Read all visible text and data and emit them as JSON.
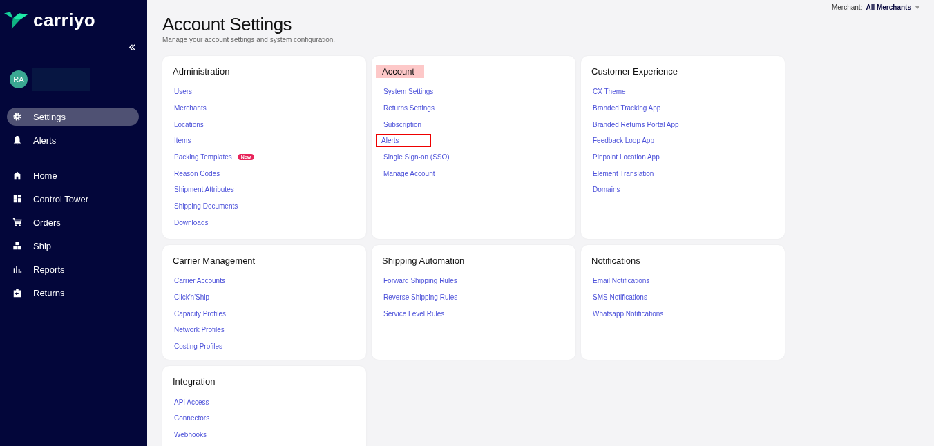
{
  "sidebar": {
    "logo_text": "carriyo",
    "avatar_initials": "RA",
    "top_items": [
      {
        "label": "Settings",
        "selected": true
      },
      {
        "label": "Alerts",
        "selected": false
      }
    ],
    "nav_items": [
      {
        "label": "Home",
        "selected": false
      },
      {
        "label": "Control Tower",
        "selected": false
      },
      {
        "label": "Orders",
        "selected": false
      },
      {
        "label": "Ship",
        "selected": false
      },
      {
        "label": "Reports",
        "selected": false
      },
      {
        "label": "Returns",
        "selected": false
      }
    ]
  },
  "header": {
    "merchant_label": "Merchant:",
    "merchant_value": "All Merchants",
    "title": "Account Settings",
    "subtitle": "Manage your account settings and system configuration."
  },
  "cards": [
    {
      "title": "Administration",
      "highlighted": false,
      "links": [
        {
          "label": "Users",
          "outlined": false
        },
        {
          "label": "Merchants",
          "outlined": false
        },
        {
          "label": "Locations",
          "outlined": false
        },
        {
          "label": "Items",
          "outlined": false
        },
        {
          "label": "Packing Templates",
          "badge": "New",
          "outlined": false
        },
        {
          "label": "Reason Codes",
          "outlined": false
        },
        {
          "label": "Shipment Attributes",
          "outlined": false
        },
        {
          "label": "Shipping Documents",
          "outlined": false
        },
        {
          "label": "Downloads",
          "outlined": false
        }
      ]
    },
    {
      "title": "Account",
      "highlighted": true,
      "links": [
        {
          "label": "System Settings",
          "outlined": false
        },
        {
          "label": "Returns Settings",
          "outlined": false
        },
        {
          "label": "Subscription",
          "outlined": false
        },
        {
          "label": "Alerts",
          "outlined": true
        },
        {
          "label": "Single Sign-on (SSO)",
          "outlined": false
        },
        {
          "label": "Manage Account",
          "outlined": false
        }
      ]
    },
    {
      "title": "Customer Experience",
      "highlighted": false,
      "links": [
        {
          "label": "CX Theme",
          "outlined": false
        },
        {
          "label": "Branded Tracking App",
          "outlined": false
        },
        {
          "label": "Branded Returns Portal App",
          "outlined": false
        },
        {
          "label": "Feedback Loop App",
          "outlined": false
        },
        {
          "label": "Pinpoint Location App",
          "outlined": false
        },
        {
          "label": "Element Translation",
          "outlined": false
        },
        {
          "label": "Domains",
          "outlined": false
        }
      ]
    },
    {
      "title": "Carrier Management",
      "highlighted": false,
      "links": [
        {
          "label": "Carrier Accounts",
          "outlined": false
        },
        {
          "label": "Click'n'Ship",
          "outlined": false
        },
        {
          "label": "Capacity Profiles",
          "outlined": false
        },
        {
          "label": "Network Profiles",
          "outlined": false
        },
        {
          "label": "Costing Profiles",
          "outlined": false
        }
      ]
    },
    {
      "title": "Shipping Automation",
      "highlighted": false,
      "links": [
        {
          "label": "Forward Shipping Rules",
          "outlined": false
        },
        {
          "label": "Reverse Shipping Rules",
          "outlined": false
        },
        {
          "label": "Service Level Rules",
          "outlined": false
        }
      ]
    },
    {
      "title": "Notifications",
      "highlighted": false,
      "links": [
        {
          "label": "Email Notifications",
          "outlined": false
        },
        {
          "label": "SMS Notifications",
          "outlined": false
        },
        {
          "label": "Whatsapp Notifications",
          "outlined": false
        }
      ]
    },
    {
      "title": "Integration",
      "highlighted": false,
      "links": [
        {
          "label": "API Access",
          "outlined": false
        },
        {
          "label": "Connectors",
          "outlined": false
        },
        {
          "label": "Webhooks",
          "outlined": false
        }
      ]
    }
  ]
}
